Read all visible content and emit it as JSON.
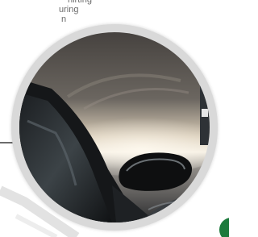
{
  "snippet": {
    "line1": "hirting",
    "line2": "uring",
    "line3": "n"
  },
  "photo": {
    "icon": "car-side-mirror-photo"
  },
  "colors": {
    "ring": "#d9d9d9",
    "accent_green": "#1d7a3c",
    "text": "#6b6b6b"
  }
}
